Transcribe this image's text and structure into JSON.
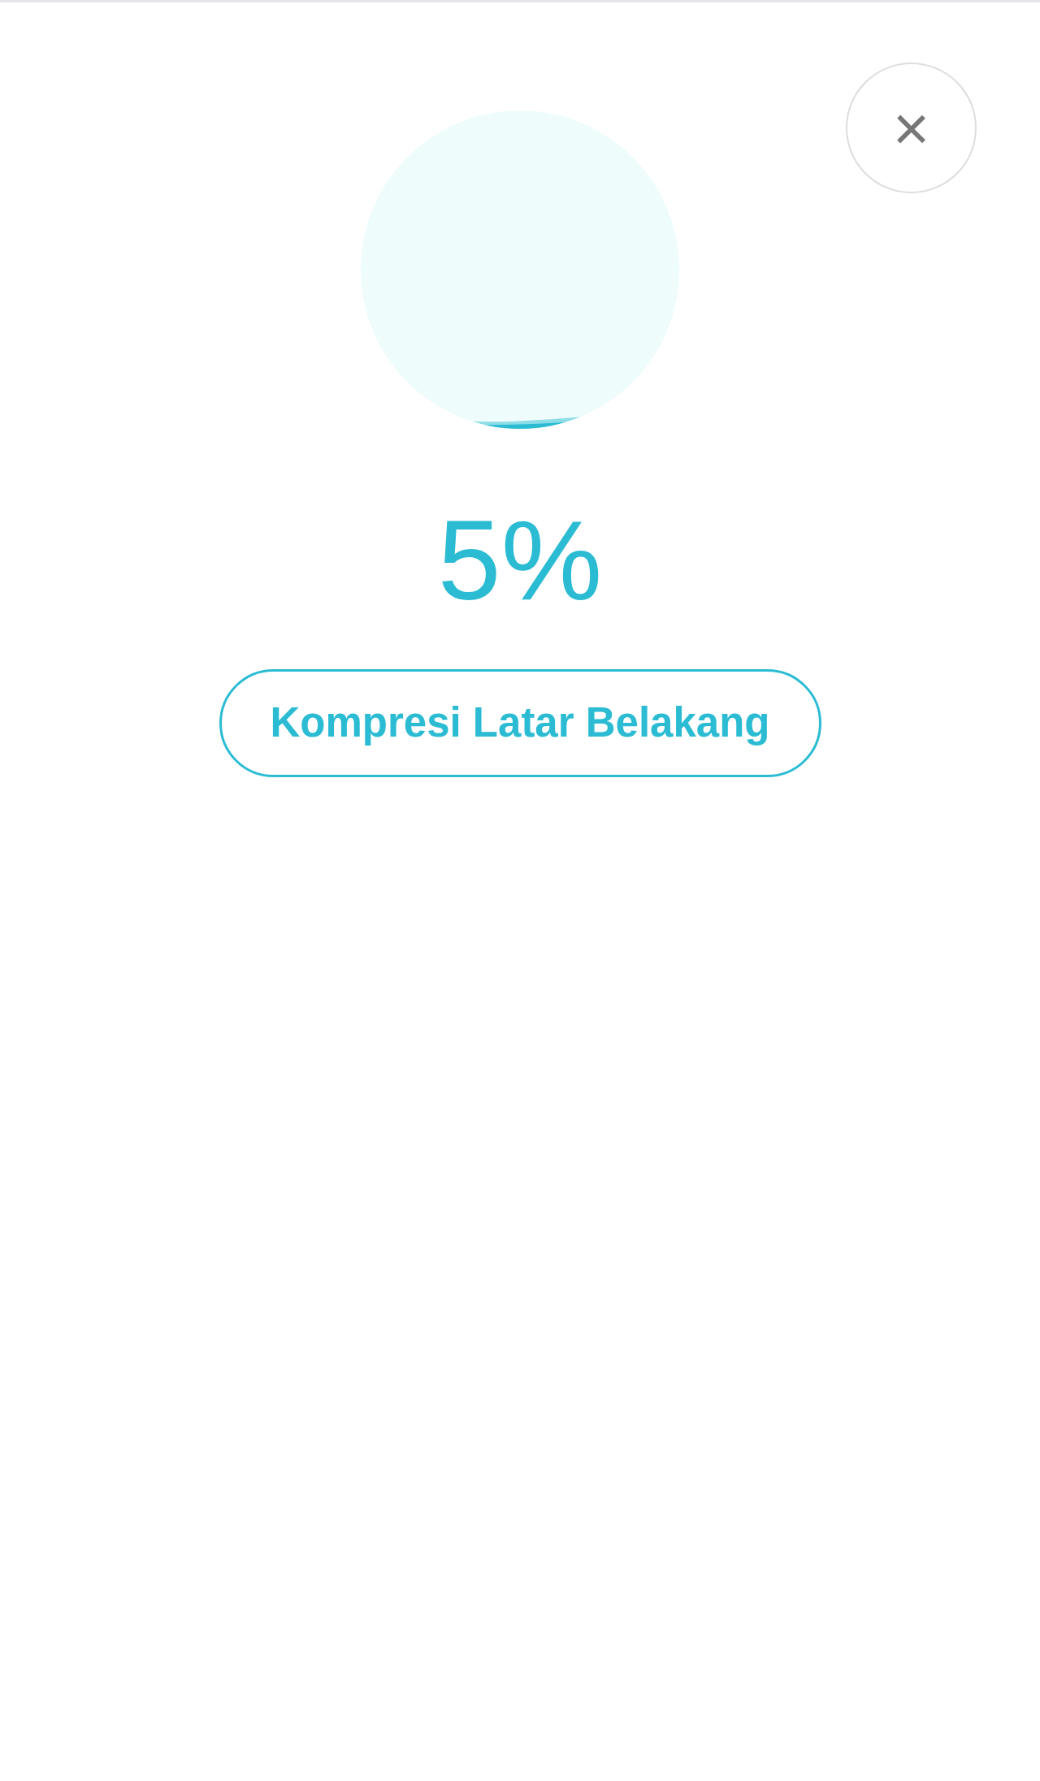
{
  "progress": {
    "reading": "5%"
  },
  "background_button": {
    "label": "Kompresi Latar Belakang"
  },
  "close_button": {
    "label": "×"
  }
}
